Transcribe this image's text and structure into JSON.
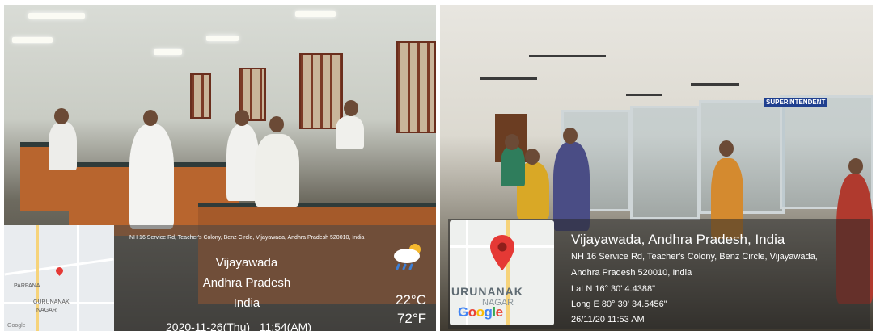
{
  "left_photo": {
    "address": "NH 16 Service Rd, Teacher's Colony, Benz Circle, Vijayawada, Andhra Pradesh 520010, India",
    "city": "Vijayawada",
    "state": "Andhra Pradesh",
    "country": "India",
    "temp_c": "22°C",
    "temp_f": "72°F",
    "datetime": "2020-11-26(Thu)   11:54(AM)",
    "map_labels": [
      "PARPANA",
      "GURUNANAK",
      "NAGAR",
      "Google"
    ],
    "weather_icon": "cloud-rain-sun-icon"
  },
  "right_photo": {
    "sign": "SUPERINTENDENT",
    "city_line": "Vijayawada, Andhra Pradesh, India",
    "address_line1": "NH 16 Service Rd, Teacher's Colony, Benz Circle, Vijayawada,",
    "address_line2": "Andhra Pradesh 520010, India",
    "lat": "Lat N 16° 30' 4.4388\"",
    "long": "Long E 80° 39' 34.5456\"",
    "datetime": "26/11/20 11:53 AM",
    "map_label": "URUNANAK",
    "map_label2": "NAGAR",
    "google": "Google",
    "pin_icon": "map-pin-icon"
  },
  "colors": {
    "pin_red": "#e53935",
    "overlay": "#464646"
  }
}
